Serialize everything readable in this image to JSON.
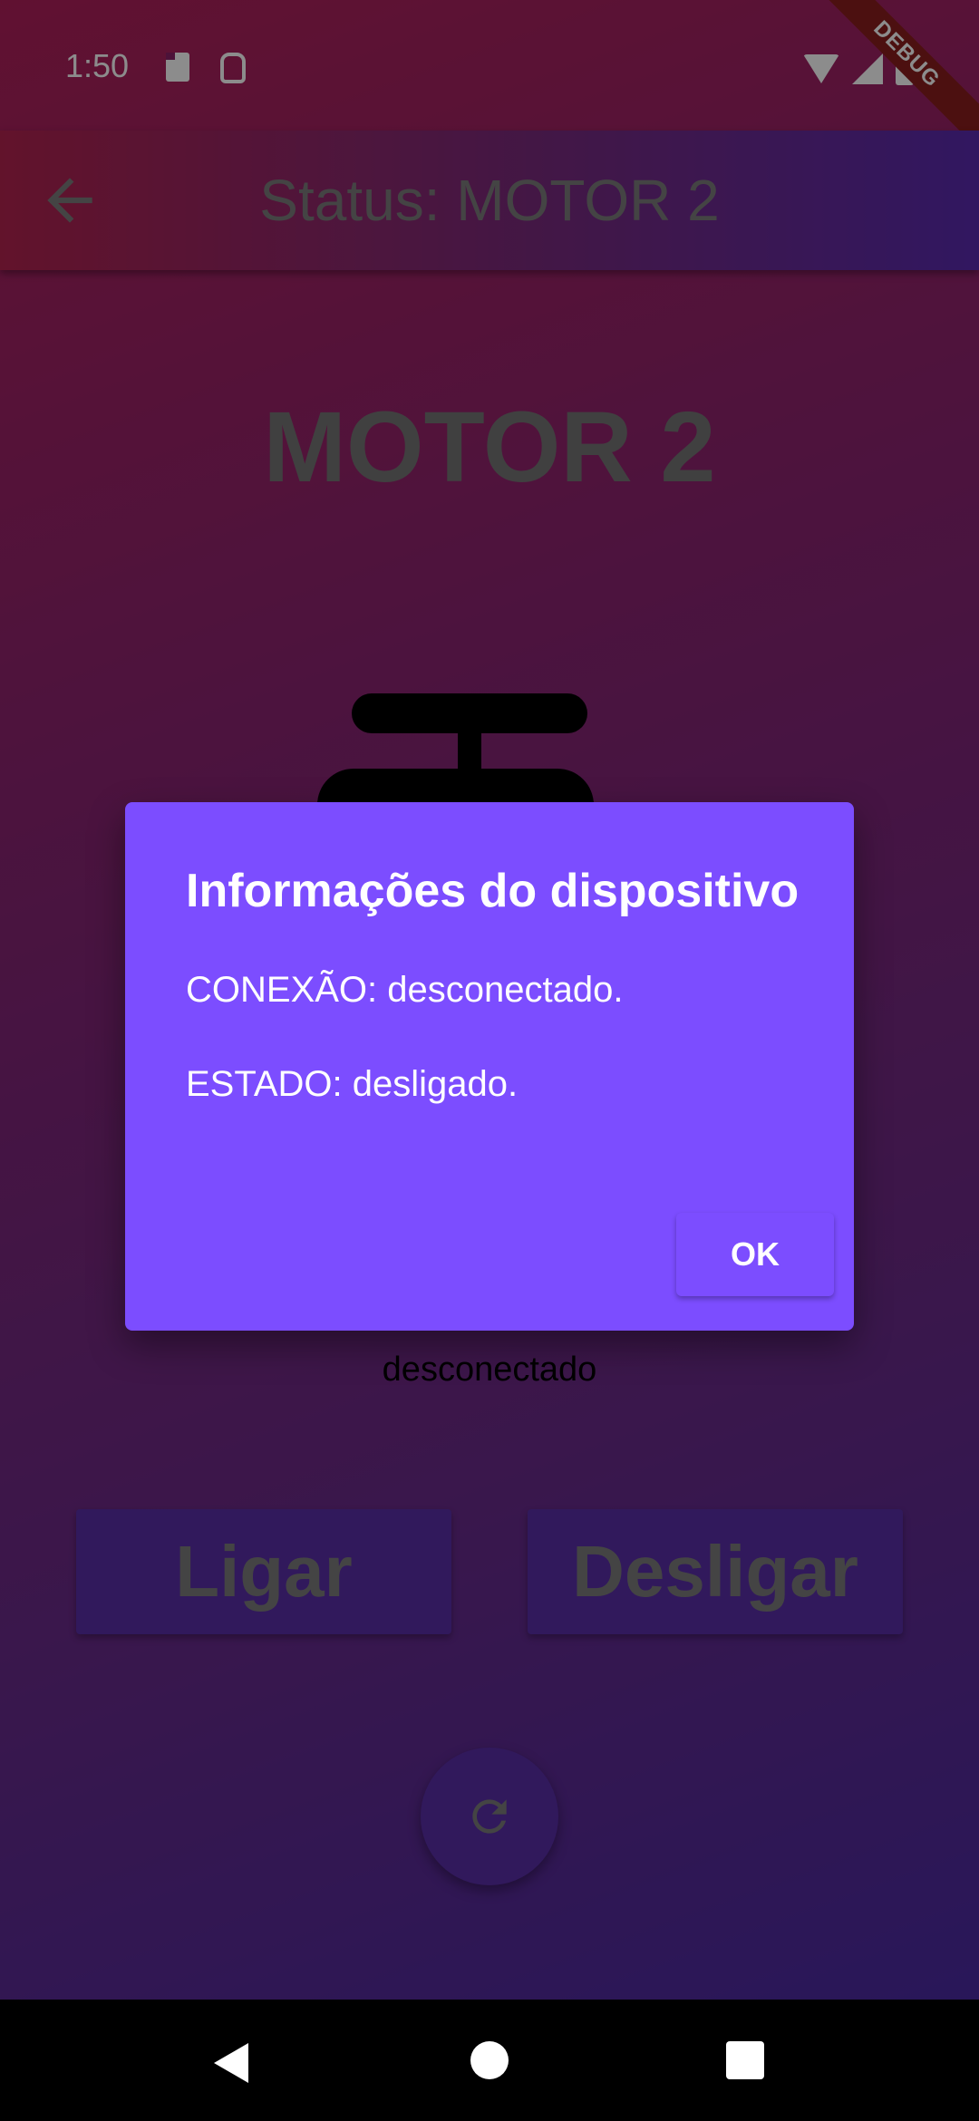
{
  "status_bar": {
    "time": "1:50",
    "debug_label": "DEBUG"
  },
  "app_bar": {
    "title": "Status: MOTOR 2",
    "back_icon": "arrow-back-icon"
  },
  "main": {
    "motor_title": "MOTOR 2",
    "motor_icon": "motor-icon",
    "connection_label": "desconectado",
    "on_button": "Ligar",
    "off_button": "Desligar",
    "refresh_icon": "refresh-icon"
  },
  "dialog": {
    "title": "Informações do dispositivo",
    "connection_line": "CONEXÃO: desconectado.",
    "state_line": "ESTADO: desligado.",
    "ok_label": "OK"
  },
  "colors": {
    "dialog_bg": "#7c4dff",
    "button_bg": "#5a2ea8",
    "text_muted": "#7d7d7d"
  }
}
